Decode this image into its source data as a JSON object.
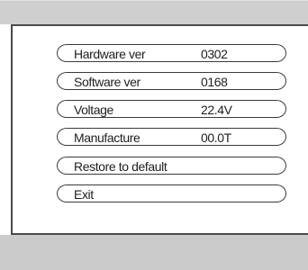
{
  "menu": {
    "items": [
      {
        "label": "Hardware ver",
        "value": "0302"
      },
      {
        "label": "Software ver",
        "value": "0168"
      },
      {
        "label": "Voltage",
        "value": "22.4V"
      },
      {
        "label": "Manufacture",
        "value": "00.0T"
      },
      {
        "label": "Restore to default",
        "value": ""
      },
      {
        "label": "Exit",
        "value": ""
      }
    ]
  }
}
